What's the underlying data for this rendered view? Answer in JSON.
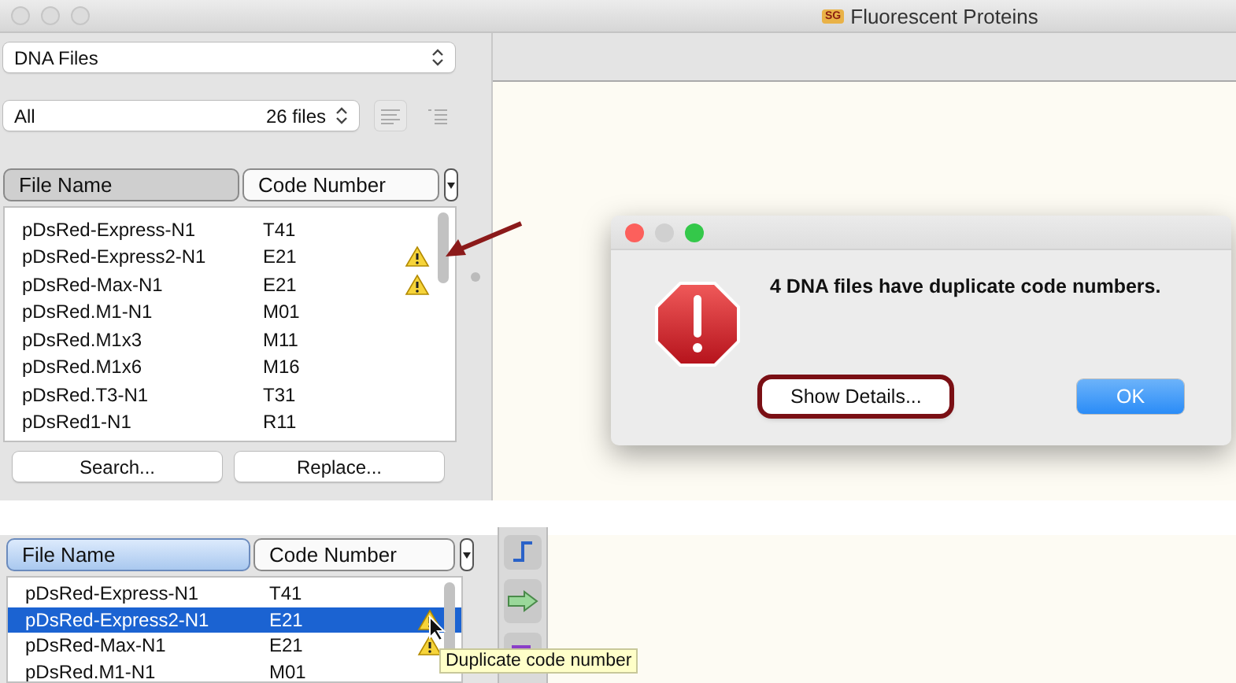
{
  "window": {
    "title": "Fluorescent Proteins",
    "icon_text": "SG"
  },
  "file_type": {
    "value": "DNA Files"
  },
  "filter": {
    "value": "All",
    "count": "26 files"
  },
  "table": {
    "columns": [
      {
        "label": "File Name",
        "selected": true
      },
      {
        "label": "Code Number",
        "selected": false
      }
    ],
    "rows": [
      {
        "name": "pDsRed-Express-N1",
        "code": "T41",
        "warning": false
      },
      {
        "name": "pDsRed-Express2-N1",
        "code": "E21",
        "warning": true
      },
      {
        "name": "pDsRed-Max-N1",
        "code": "E21",
        "warning": true
      },
      {
        "name": "pDsRed.M1-N1",
        "code": "M01",
        "warning": false
      },
      {
        "name": "pDsRed.M1x3",
        "code": "M11",
        "warning": false
      },
      {
        "name": "pDsRed.M1x6",
        "code": "M16",
        "warning": false
      },
      {
        "name": "pDsRed.T3-N1",
        "code": "T31",
        "warning": false
      },
      {
        "name": "pDsRed1-N1",
        "code": "R11",
        "warning": false
      }
    ]
  },
  "buttons": [
    "Search...",
    "Replace..."
  ],
  "dialog": {
    "message": "4 DNA files have duplicate code numbers.",
    "buttons": [
      {
        "label": "Show Details...",
        "default": false,
        "highlighted": true
      },
      {
        "label": "OK",
        "default": true,
        "highlighted": false
      }
    ]
  },
  "detail": {
    "columns": [
      {
        "label": "File Name",
        "selected": true
      },
      {
        "label": "Code Number",
        "selected": false
      }
    ],
    "rows": [
      {
        "name": "pDsRed-Express-N1",
        "code": "T41",
        "warning": false,
        "selected": false
      },
      {
        "name": "pDsRed-Express2-N1",
        "code": "E21",
        "warning": true,
        "selected": true
      },
      {
        "name": "pDsRed-Max-N1",
        "code": "E21",
        "warning": true,
        "selected": false
      },
      {
        "name": "pDsRed.M1-N1",
        "code": "M01",
        "warning": false,
        "selected": false
      }
    ],
    "tooltip": "Duplicate code number"
  }
}
